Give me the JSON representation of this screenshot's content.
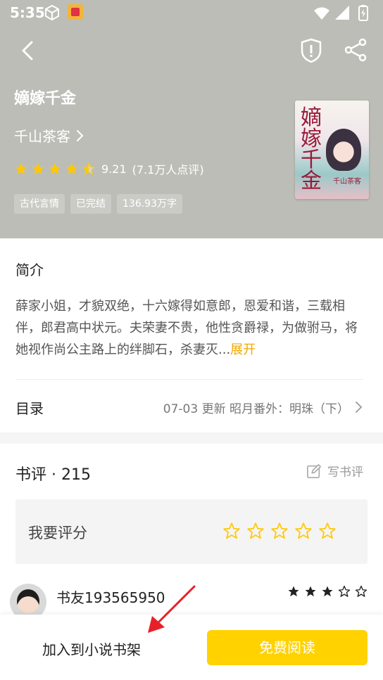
{
  "status_bar": {
    "time": "5:35"
  },
  "book": {
    "title": "嫡嫁千金",
    "author": "千山茶客",
    "rating": "9.21",
    "rating_count": "(7.1万人点评)",
    "rating_stars": 4.5,
    "tags": [
      "古代言情",
      "已完结",
      "136.93万字"
    ],
    "cover": {
      "title": "嫡嫁千金",
      "author": "千山茶客",
      "accent": "#9a1a3a"
    }
  },
  "intro": {
    "heading": "简介",
    "text": "薛家小姐，才貌双绝，十六嫁得如意郎，恩爱和谐，三载相伴，郎君高中状元。夫荣妻不贵，他性贪爵禄，为做驸马，将她视作尚公主路上的绊脚石，杀妻灭...",
    "expand": "展开"
  },
  "toc": {
    "label": "目录",
    "info": "07-03  更新  昭月番外：明珠（下）"
  },
  "reviews": {
    "heading": "书评 · 215",
    "write": "写书评",
    "rate_label": "我要评分",
    "rate_stars": 5,
    "items": [
      {
        "name": "书友193565950",
        "stars": 3,
        "stars_total": 5
      }
    ]
  },
  "bottom": {
    "add_shelf": "加入到小说书架",
    "read": "免费阅读"
  },
  "colors": {
    "hero_bg": "#bdbdb7",
    "accent": "#ffd200",
    "star": "#ffc800",
    "link": "#f2a800"
  },
  "icons": [
    "cube-icon",
    "app-icon",
    "wifi-icon",
    "signal-icon",
    "battery-icon",
    "back-icon",
    "shield-icon",
    "share-icon",
    "chevron-right-icon",
    "star-icon",
    "edit-icon",
    "arrow-annotation"
  ]
}
